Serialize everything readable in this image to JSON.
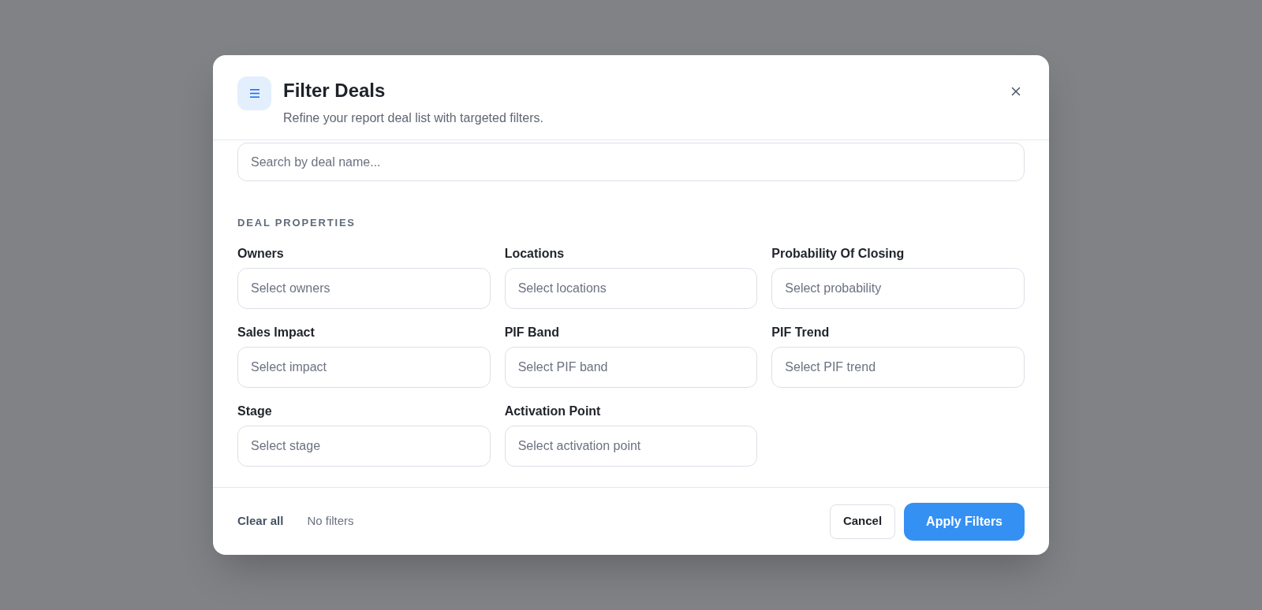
{
  "dialog": {
    "title": "Filter Deals",
    "subtitle": "Refine your report deal list with targeted filters."
  },
  "search": {
    "placeholder": "Search by deal name..."
  },
  "section": {
    "heading": "DEAL PROPERTIES",
    "filters": [
      {
        "label": "Owners",
        "placeholder": "Select owners"
      },
      {
        "label": "Locations",
        "placeholder": "Select locations"
      },
      {
        "label": "Probability Of Closing",
        "placeholder": "Select probability"
      },
      {
        "label": "Sales Impact",
        "placeholder": "Select impact"
      },
      {
        "label": "PIF Band",
        "placeholder": "Select PIF band"
      },
      {
        "label": "PIF Trend",
        "placeholder": "Select PIF trend"
      },
      {
        "label": "Stage",
        "placeholder": "Select stage"
      },
      {
        "label": "Activation Point",
        "placeholder": "Select activation point"
      }
    ]
  },
  "footer": {
    "clear_all": "Clear all",
    "status": "No filters",
    "buttons": [
      {
        "label": "Cancel",
        "kind": "secondary"
      },
      {
        "label": "Apply Filters",
        "kind": "primary"
      }
    ]
  }
}
